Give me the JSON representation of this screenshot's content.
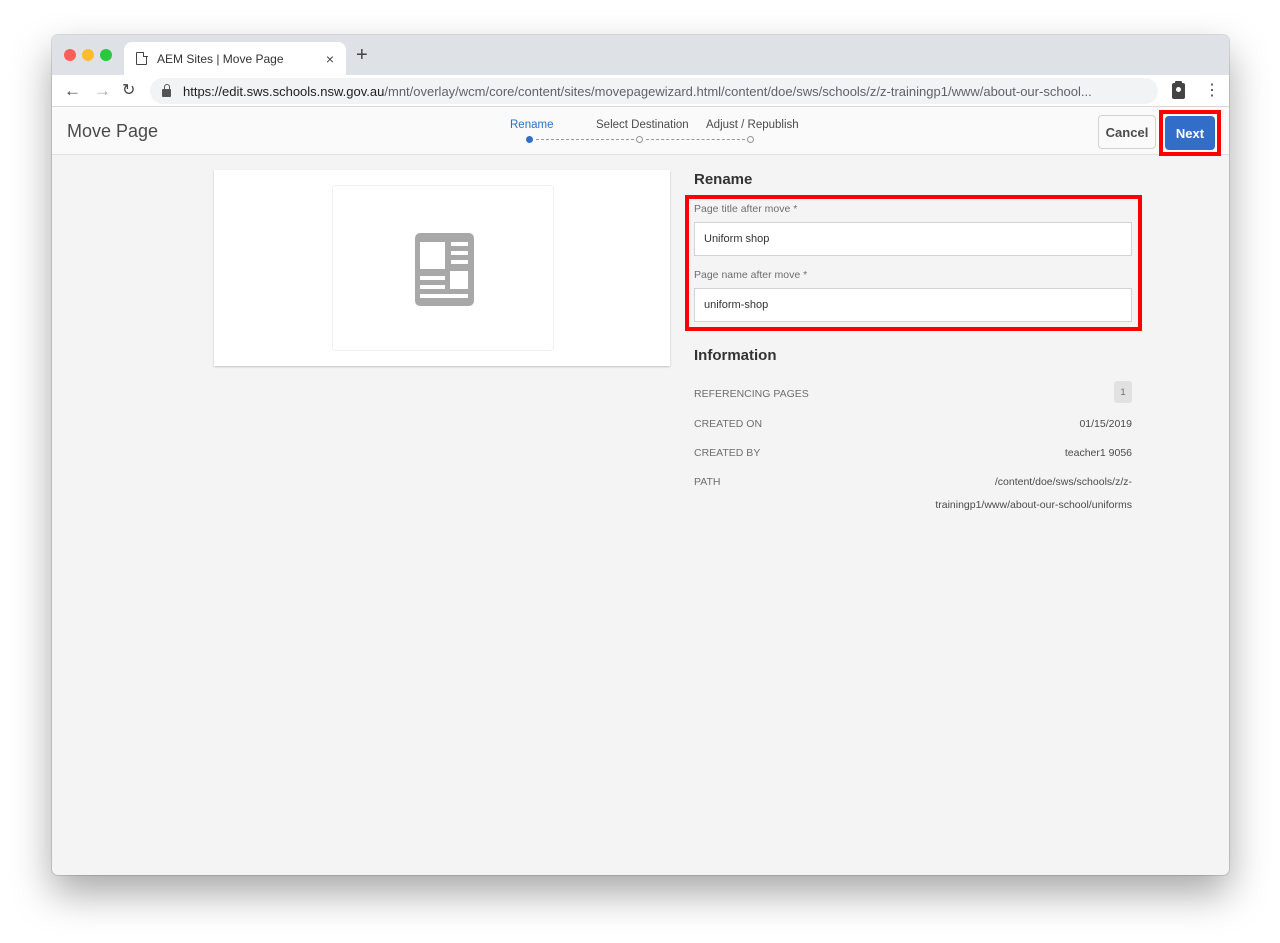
{
  "browser": {
    "tab_title": "AEM Sites | Move Page",
    "tab_close": "×",
    "new_tab": "+",
    "url_host": "https://edit.sws.schools.nsw.gov.au",
    "url_path": "/mnt/overlay/wcm/core/content/sites/movepagewizard.html/content/doe/sws/schools/z/z-trainingp1/www/about-our-school...",
    "back": "←",
    "forward": "→",
    "reload": "C",
    "menu": "⋮"
  },
  "header": {
    "title": "Move Page",
    "steps": [
      {
        "label": "Rename",
        "active": true
      },
      {
        "label": "Select Destination",
        "active": false
      },
      {
        "label": "Adjust / Republish",
        "active": false
      }
    ],
    "cancel_label": "Cancel",
    "next_label": "Next"
  },
  "colors": {
    "accent": "#326ec8",
    "highlight": "#ff0000",
    "icon_gray": "#a8a8a8"
  },
  "rename": {
    "section_title": "Rename",
    "title_label": "Page title after move *",
    "title_value": "Uniform shop",
    "name_label": "Page name after move *",
    "name_value": "uniform-shop"
  },
  "information": {
    "section_title": "Information",
    "rows": [
      {
        "key": "REFERENCING PAGES",
        "value": "1"
      },
      {
        "key": "CREATED ON",
        "value": "01/15/2019"
      },
      {
        "key": "CREATED BY",
        "value": "teacher1 9056"
      },
      {
        "key": "PATH",
        "value": "/content/doe/sws/schools/z/z-trainingp1/www/about-our-school/uniforms"
      }
    ]
  }
}
